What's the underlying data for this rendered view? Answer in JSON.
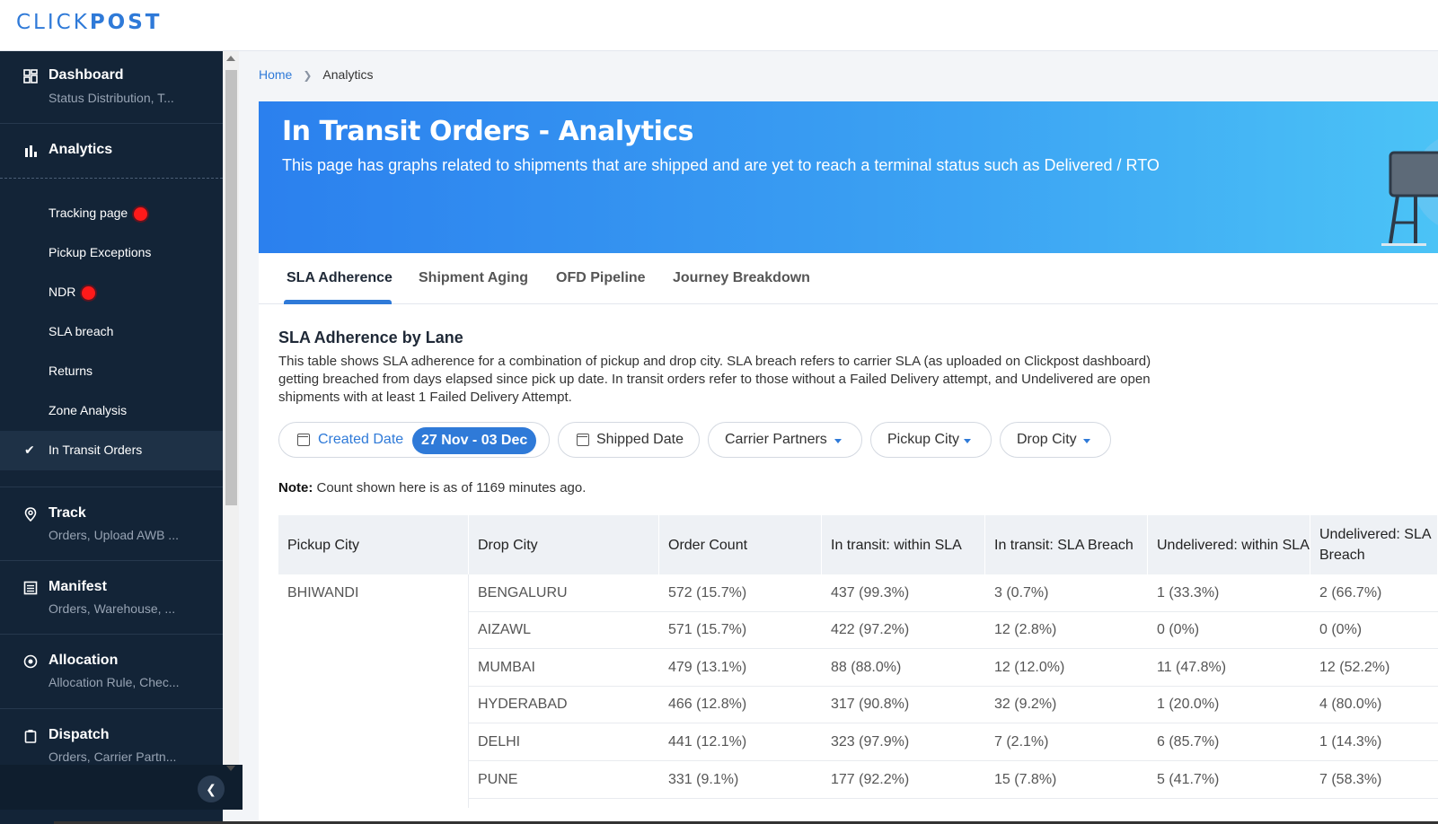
{
  "app": {
    "logo_part1": "CLICK",
    "logo_part2": "POST"
  },
  "sidebar": {
    "sections": [
      {
        "title": "Dashboard",
        "subtitle": "Status Distribution, T...",
        "icon": "dashboard-grid-icon"
      },
      {
        "title": "Analytics",
        "icon": "bar-chart-icon"
      },
      {
        "title": "Track",
        "subtitle": "Orders, Upload AWB ...",
        "icon": "location-pin-icon"
      },
      {
        "title": "Manifest",
        "subtitle": "Orders, Warehouse, ...",
        "icon": "list-icon"
      },
      {
        "title": "Allocation",
        "subtitle": "Allocation Rule, Chec...",
        "icon": "target-icon"
      },
      {
        "title": "Dispatch",
        "subtitle": "Orders, Carrier Partn...",
        "icon": "clipboard-icon"
      }
    ],
    "analytics_items": [
      {
        "label": "Tracking page",
        "alert": true
      },
      {
        "label": "Pickup Exceptions",
        "alert": false
      },
      {
        "label": "NDR",
        "alert": true
      },
      {
        "label": "SLA breach",
        "alert": false
      },
      {
        "label": "Returns",
        "alert": false
      },
      {
        "label": "Zone Analysis",
        "alert": false
      },
      {
        "label": "In Transit Orders",
        "alert": false,
        "active": true
      }
    ]
  },
  "breadcrumb": {
    "home": "Home",
    "current": "Analytics"
  },
  "banner": {
    "title": "In Transit Orders - Analytics",
    "description": "This page has graphs related to shipments that are shipped and are yet to reach a terminal status such as Delivered / RTO"
  },
  "tabs": [
    "SLA Adherence",
    "Shipment Aging",
    "OFD Pipeline",
    "Journey Breakdown"
  ],
  "active_tab": "SLA Adherence",
  "section": {
    "title": "SLA Adherence by Lane",
    "description": "This table shows SLA adherence for a combination of pickup and drop city. SLA breach refers to carrier SLA (as uploaded on Clickpost dashboard) getting breached from days elapsed since pick up date. In transit orders refer to those without a Failed Delivery attempt, and Undelivered are open shipments with at least 1 Failed Delivery Attempt."
  },
  "filters": {
    "created_date_label": "Created Date",
    "created_date_value": "27 Nov - 03 Dec",
    "shipped_date_label": "Shipped Date",
    "carrier_partners": "Carrier Partners",
    "pickup_city": "Pickup City",
    "drop_city": "Drop City"
  },
  "note": {
    "label": "Note:",
    "text": "Count shown here is as of 1169 minutes ago."
  },
  "table": {
    "headers": [
      "Pickup City",
      "Drop City",
      "Order Count",
      "In transit: within SLA",
      "In transit: SLA Breach",
      "Undelivered: within SLA",
      "Undelivered: SLA Breach"
    ],
    "pickup_city": "BHIWANDI",
    "rows": [
      [
        "BENGALURU",
        "572 (15.7%)",
        "437 (99.3%)",
        "3 (0.7%)",
        "1 (33.3%)",
        "2 (66.7%)"
      ],
      [
        "AIZAWL",
        "571 (15.7%)",
        "422 (97.2%)",
        "12 (2.8%)",
        "0 (0%)",
        "0 (0%)"
      ],
      [
        "MUMBAI",
        "479 (13.1%)",
        "88 (88.0%)",
        "12 (12.0%)",
        "11 (47.8%)",
        "12 (52.2%)"
      ],
      [
        "HYDERABAD",
        "466 (12.8%)",
        "317 (90.8%)",
        "32 (9.2%)",
        "1 (20.0%)",
        "4 (80.0%)"
      ],
      [
        "DELHI",
        "441 (12.1%)",
        "323 (97.9%)",
        "7 (2.1%)",
        "6 (85.7%)",
        "1 (14.3%)"
      ],
      [
        "PUNE",
        "331 (9.1%)",
        "177 (92.2%)",
        "15 (7.8%)",
        "5 (41.7%)",
        "7 (58.3%)"
      ]
    ]
  },
  "colors": {
    "accent": "#2f7ad8",
    "sidebar_bg": "#132437",
    "alert": "#ff1a1a"
  }
}
